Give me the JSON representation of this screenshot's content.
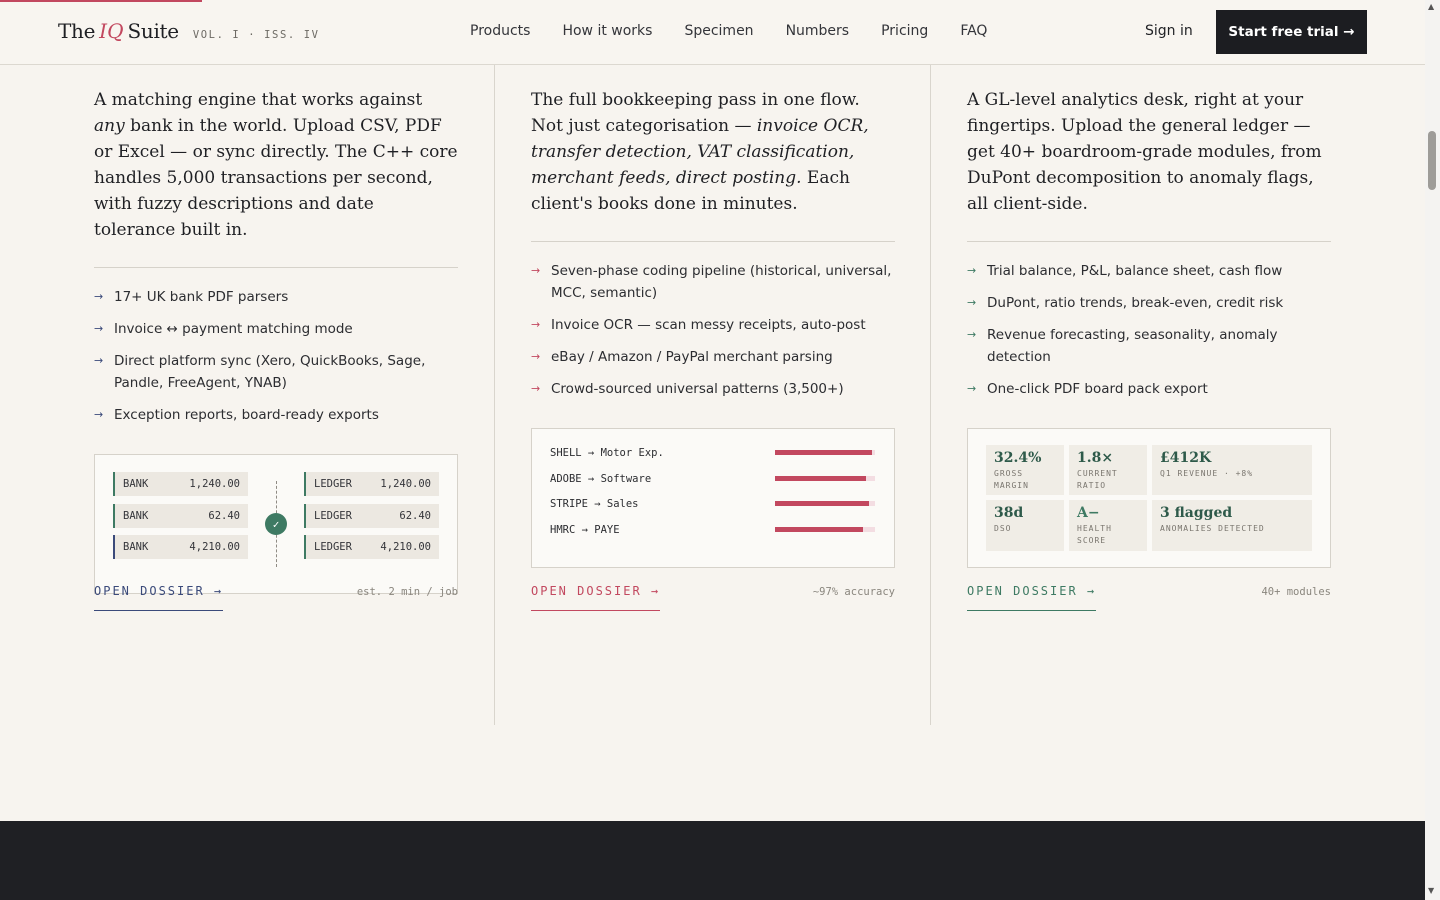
{
  "header": {
    "brand_pre": "The",
    "brand_iq": "IQ",
    "brand_post": "Suite",
    "issue": "VOL. I · ISS. IV",
    "nav": [
      "Products",
      "How it works",
      "Specimen",
      "Numbers",
      "Pricing",
      "FAQ"
    ],
    "signin": "Sign in",
    "cta": "Start free trial →",
    "reading_progress": 0.14
  },
  "columns": [
    {
      "lead_html_parts": [
        "A matching engine that works against ",
        "any",
        " bank in the world. Upload CSV, PDF or Excel — or sync directly. The C++ core handles 5,000 transactions per second, with fuzzy descriptions and date tolerance built in."
      ],
      "features": [
        "17+ UK bank PDF parsers",
        "Invoice ↔ payment matching mode",
        "Direct platform sync (Xero, QuickBooks, Sage, Pandle, FreeAgent, YNAB)",
        "Exception reports, board-ready exports"
      ],
      "match_rows": [
        {
          "left_label": "BANK",
          "left_amount": "1,240.00",
          "right_label": "LEDGER",
          "right_amount": "1,240.00"
        },
        {
          "left_label": "BANK",
          "left_amount": "62.40",
          "right_label": "LEDGER",
          "right_amount": "62.40"
        },
        {
          "left_label": "BANK",
          "left_amount": "4,210.00",
          "right_label": "LEDGER",
          "right_amount": "4,210.00"
        }
      ],
      "check_icon": "✓",
      "cta": "OPEN DOSSIER →",
      "meta": "est. 2 min / job",
      "accent": "#3b4a7a"
    },
    {
      "lead_html_parts": [
        "The full bookkeeping pass in one flow. Not just categorisation — ",
        "invoice OCR, transfer detection, VAT classification, merchant feeds, direct posting.",
        " Each client's books done in minutes."
      ],
      "features": [
        "Seven-phase coding pipeline (historical, universal, MCC, semantic)",
        "Invoice OCR — scan messy receipts, auto-post",
        "eBay / Amazon / PayPal merchant parsing",
        "Crowd-sourced universal patterns (3,500+)"
      ],
      "coding_rows": [
        {
          "label": "SHELL → Motor Exp.",
          "confidence": 0.97
        },
        {
          "label": "ADOBE → Software",
          "confidence": 0.91
        },
        {
          "label": "STRIPE → Sales",
          "confidence": 0.94
        },
        {
          "label": "HMRC → PAYE",
          "confidence": 0.88
        }
      ],
      "cta": "OPEN DOSSIER →",
      "meta": "~97% accuracy",
      "accent": "#c2485f"
    },
    {
      "lead": "A GL-level analytics desk, right at your fingertips. Upload the general ledger — get 40+ boardroom-grade modules, from DuPont decomposition to anomaly flags, all client-side.",
      "features": [
        "Trial balance, P&L, balance sheet, cash flow",
        "DuPont, ratio trends, break-even, credit risk",
        "Revenue forecasting, seasonality, anomaly detection",
        "One-click PDF board pack export"
      ],
      "kpis": [
        {
          "value": "32.4%",
          "label": "GROSS MARGIN"
        },
        {
          "value": "1.8×",
          "label": "CURRENT RATIO"
        },
        {
          "value": "£412K",
          "label": "Q1 REVENUE · +8%"
        },
        {
          "value": "38d",
          "label": "DSO"
        },
        {
          "value": "A−",
          "label": "HEALTH SCORE"
        },
        {
          "value": "3 flagged",
          "label": "ANOMALIES DETECTED"
        }
      ],
      "cta": "OPEN DOSSIER →",
      "meta": "40+ modules",
      "accent": "#3e7a63"
    }
  ],
  "feature_arrow": "→",
  "scrollbar": {
    "up": "▲",
    "down": "▼"
  }
}
